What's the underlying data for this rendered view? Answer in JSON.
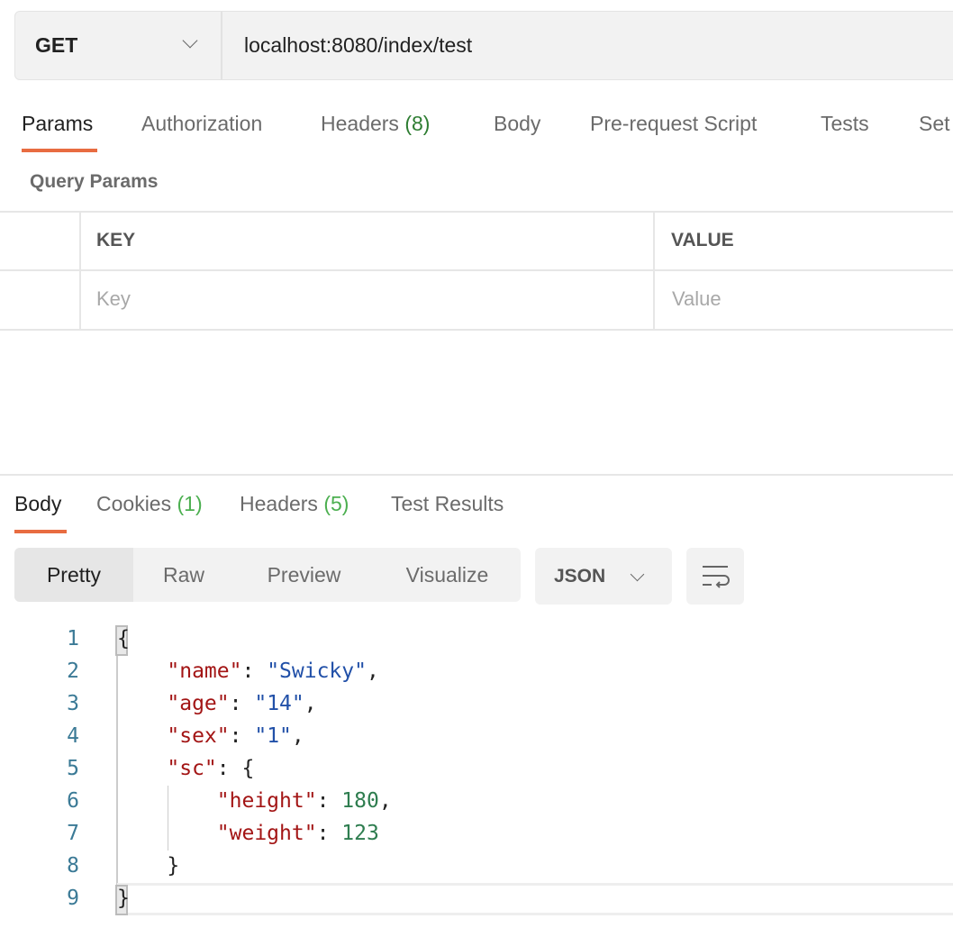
{
  "request": {
    "method": "GET",
    "url": "localhost:8080/index/test"
  },
  "request_tabs": [
    {
      "label": "Params",
      "active": true
    },
    {
      "label": "Authorization"
    },
    {
      "label": "Headers",
      "count": "(8)"
    },
    {
      "label": "Body"
    },
    {
      "label": "Pre-request Script"
    },
    {
      "label": "Tests"
    },
    {
      "label": "Set"
    }
  ],
  "query_params": {
    "title": "Query Params",
    "headers": [
      "KEY",
      "VALUE"
    ],
    "placeholders": {
      "key": "Key",
      "value": "Value"
    }
  },
  "response_tabs": [
    {
      "label": "Body",
      "active": true
    },
    {
      "label": "Cookies",
      "count": "(1)"
    },
    {
      "label": "Headers",
      "count": "(5)"
    },
    {
      "label": "Test Results"
    }
  ],
  "view_modes": [
    "Pretty",
    "Raw",
    "Preview",
    "Visualize"
  ],
  "active_view_mode": "Pretty",
  "format": "JSON",
  "accent_color": "#e86c41",
  "code_lines": [
    {
      "n": "1",
      "text": "{"
    },
    {
      "n": "2",
      "key": "\"name\"",
      "val": "\"Swicky\"",
      "type": "s",
      "tail": ","
    },
    {
      "n": "3",
      "key": "\"age\"",
      "val": "\"14\"",
      "type": "s",
      "tail": ","
    },
    {
      "n": "4",
      "key": "\"sex\"",
      "val": "\"1\"",
      "type": "s",
      "tail": ","
    },
    {
      "n": "5",
      "key": "\"sc\"",
      "val": "{",
      "type": "p",
      "tail": ""
    },
    {
      "n": "6",
      "key": "\"height\"",
      "val": "180",
      "type": "n",
      "tail": ","
    },
    {
      "n": "7",
      "key": "\"weight\"",
      "val": "123",
      "type": "n",
      "tail": ""
    },
    {
      "n": "8",
      "text": "}"
    },
    {
      "n": "9",
      "text": "}"
    }
  ]
}
